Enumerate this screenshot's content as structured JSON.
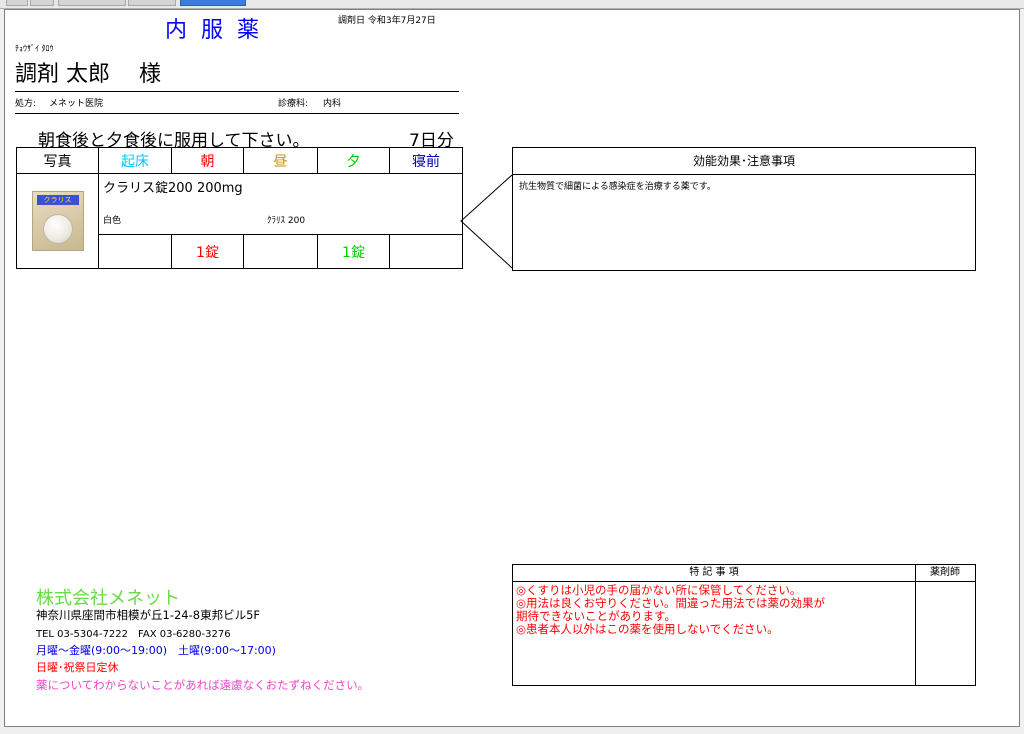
{
  "window": {
    "tabs": [
      "",
      "",
      "",
      "",
      ""
    ]
  },
  "header": {
    "title": "内服薬",
    "dispense_date": "調剤日 令和3年7月27日",
    "furigana": "ﾁｮｳｻﾞｲ ﾀﾛｳ",
    "patient_name": "調剤 太郎",
    "honorific": "様",
    "prescriber_label": "処方:",
    "prescriber": "メネット医院",
    "department_label": "診療科:",
    "department": "内科"
  },
  "instruction": {
    "text": "朝食後と夕食後に服用して下さい。",
    "days": "7日分"
  },
  "med_table": {
    "headers": {
      "photo": "写真",
      "kisho": "起床",
      "asa": "朝",
      "hiru": "昼",
      "yu": "夕",
      "shushin": "寝前"
    },
    "drug": {
      "name": "クラリス錠200 200mg",
      "color": "白色",
      "code": "ｸﾗﾘｽ 200",
      "image_brand": "クラリス",
      "doses": {
        "kisho": "",
        "asa": "1錠",
        "hiru": "",
        "yu": "1錠",
        "shushin": ""
      }
    }
  },
  "effects": {
    "header": "効能効果･注意事項",
    "text": "抗生物質で細菌による感染症を治療する薬です。"
  },
  "pharmacy": {
    "name": "株式会社メネット",
    "address": "神奈川県座間市相模が丘1-24-8東邦ビル5F",
    "tel_fax": "TEL 03-5304-7222　FAX 03-6280-3276",
    "hours": "月曜～金曜(9:00～19:00)　土曜(9:00～17:00)",
    "closed": "日曜･祝祭日定休",
    "message": "薬についてわからないことがあれば遠慮なくおたずねください。"
  },
  "notes": {
    "header": "特 記 事 項",
    "pharmacist_label": "薬剤師",
    "lines": [
      "◎くすりは小児の手の届かない所に保管してください。",
      "◎用法は良くお守りください。間違った用法では薬の効果が",
      "期待できないことがあります。",
      "◎患者本人以外はこの薬を使用しないでください。"
    ]
  },
  "colors": {
    "title": "#0000ff",
    "kisho": "#00c8ff",
    "asa": "#ff0000",
    "hiru": "#d09000",
    "yu": "#00cc00",
    "shushin": "#0000aa",
    "pharmacy_name": "#66dd44",
    "hours": "#0000dd",
    "closed": "#ff0000",
    "message": "#ee44cc",
    "notes": "#ff0000"
  }
}
